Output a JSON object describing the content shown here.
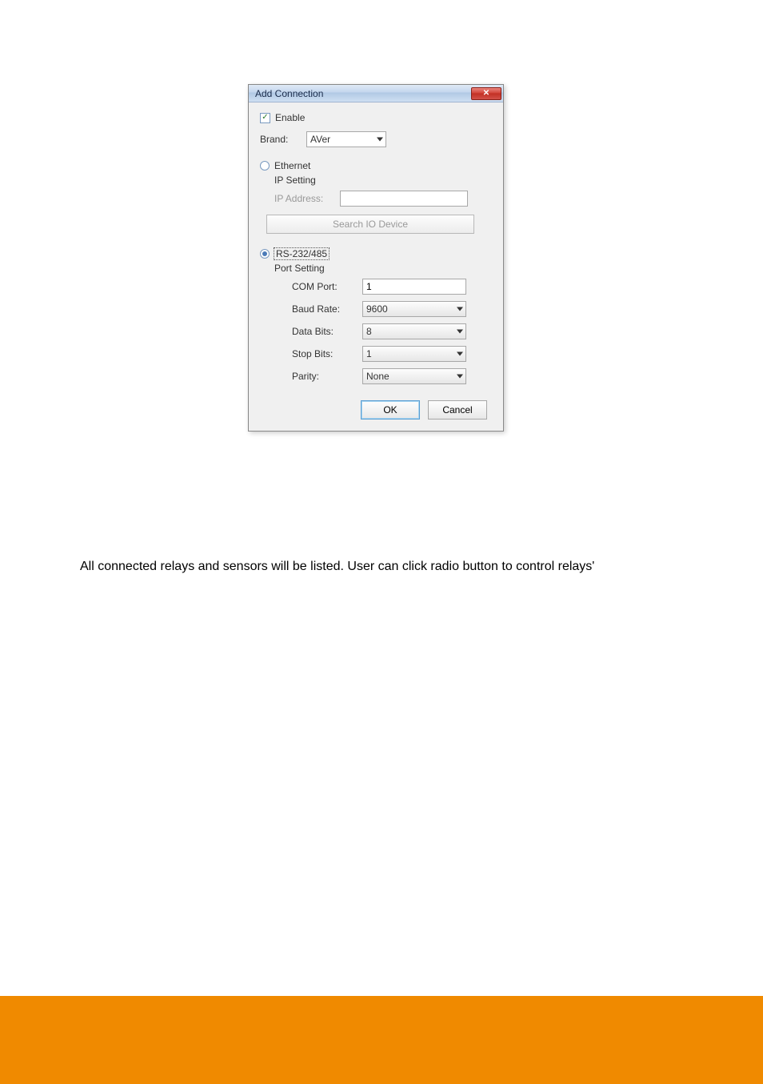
{
  "dialog": {
    "title": "Add Connection",
    "enable_label": "Enable",
    "enable_checked": true,
    "brand_label": "Brand:",
    "brand_value": "AVer",
    "ethernet": {
      "radio_label": "Ethernet",
      "selected": false,
      "ip_setting_label": "IP Setting",
      "ip_address_label": "IP Address:",
      "ip_address_value": "",
      "search_button": "Search IO Device"
    },
    "rs232": {
      "radio_label": "RS-232/485",
      "selected": true,
      "port_setting_label": "Port Setting",
      "com_port_label": "COM Port:",
      "com_port_value": "1",
      "baud_rate_label": "Baud Rate:",
      "baud_rate_value": "9600",
      "data_bits_label": "Data Bits:",
      "data_bits_value": "8",
      "stop_bits_label": "Stop Bits:",
      "stop_bits_value": "1",
      "parity_label": "Parity:",
      "parity_value": "None"
    },
    "ok_label": "OK",
    "cancel_label": "Cancel"
  },
  "body_text": "All connected relays and sensors will be listed. User can click radio button to control relays'"
}
